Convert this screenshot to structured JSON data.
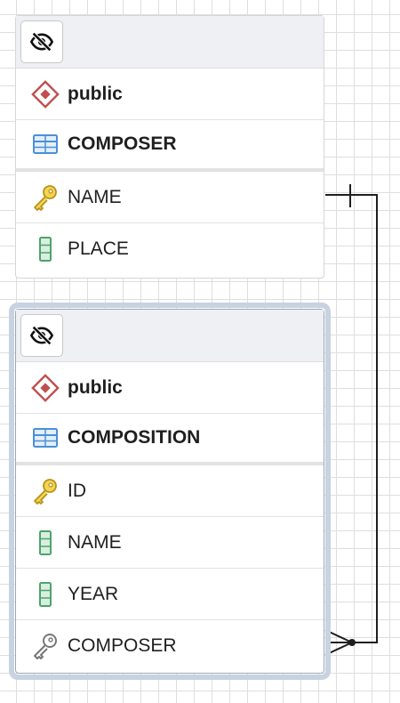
{
  "tables": [
    {
      "id": "composer",
      "schema": "public",
      "name": "COMPOSER",
      "columns": [
        {
          "name": "NAME",
          "kind": "primary-key"
        },
        {
          "name": "PLACE",
          "kind": "column"
        }
      ]
    },
    {
      "id": "composition",
      "schema": "public",
      "name": "COMPOSITION",
      "selected": true,
      "columns": [
        {
          "name": "ID",
          "kind": "primary-key"
        },
        {
          "name": "NAME",
          "kind": "column"
        },
        {
          "name": "YEAR",
          "kind": "column"
        },
        {
          "name": "COMPOSER",
          "kind": "foreign-key"
        }
      ]
    }
  ],
  "relationships": [
    {
      "from": "COMPOSER.NAME",
      "to": "COMPOSITION.COMPOSER",
      "from_cardinality": "one",
      "to_cardinality": "many"
    }
  ],
  "colors": {
    "schema_icon": "#c0504d",
    "table_icon": "#4a90d9",
    "primary_key": "#e2b91c",
    "column_icon": "#4fa36b",
    "foreign_key": "#8a8a8a",
    "selection": "#c8d3e1"
  }
}
